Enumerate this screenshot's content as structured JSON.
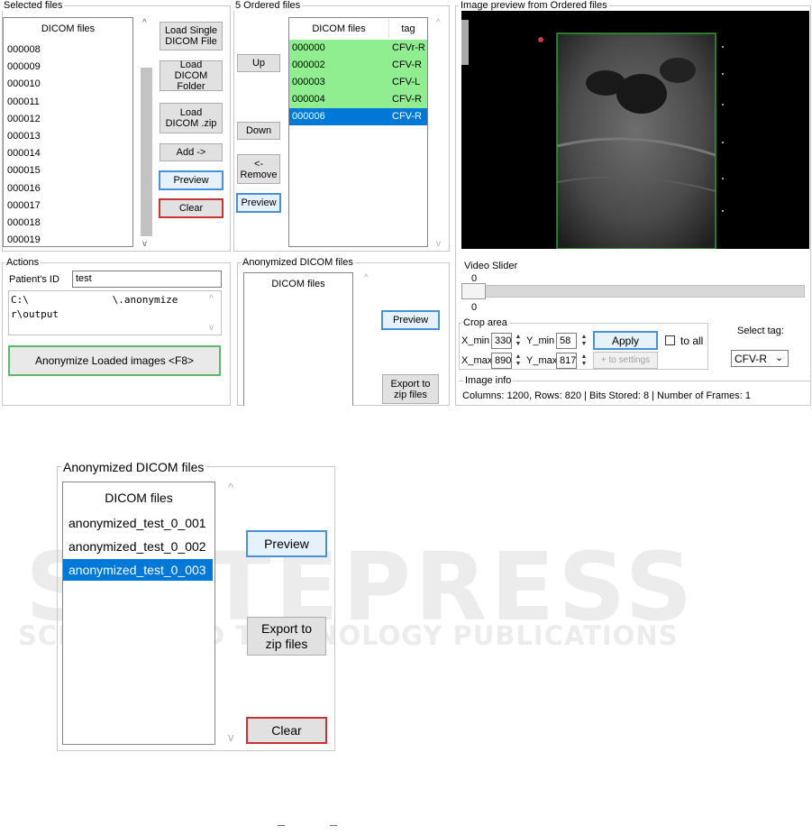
{
  "selected_files": {
    "title": "Selected files",
    "header": "DICOM files",
    "items": [
      "000008",
      "000009",
      "000010",
      "000011",
      "000012",
      "000013",
      "000014",
      "000015",
      "000016",
      "000017",
      "000018",
      "000019"
    ],
    "buttons": {
      "load_single": "Load Single\nDICOM File",
      "load_folder": "Load DICOM\nFolder",
      "load_zip": "Load\nDICOM .zip",
      "add": "Add ->",
      "preview": "Preview",
      "clear": "Clear"
    }
  },
  "ordered_files": {
    "title": "5 Ordered files",
    "header_files": "DICOM files",
    "header_tag": "tag",
    "rows": [
      {
        "file": "000000",
        "tag": "CFVr-R"
      },
      {
        "file": "000002",
        "tag": "CFV-R"
      },
      {
        "file": "000003",
        "tag": "CFV-L"
      },
      {
        "file": "000004",
        "tag": "CFV-R"
      },
      {
        "file": "000006",
        "tag": "CFV-R"
      }
    ],
    "buttons": {
      "up": "Up",
      "down": "Down",
      "remove": "<-\nRemove",
      "preview": "Preview"
    }
  },
  "image_preview": {
    "title": "Image preview from Ordered files",
    "video_slider_label": "Video Slider",
    "slider_value_top": "0",
    "slider_value_bottom": "0",
    "crop": {
      "title": "Crop area",
      "x_min_label": "X_min",
      "x_min": "330",
      "y_min_label": "Y_min",
      "y_min": "58",
      "x_max_label": "X_max",
      "x_max": "890",
      "y_max_label": "Y_max",
      "y_max": "817",
      "apply": "Apply",
      "to_all": "to all",
      "to_settings": "+ to settings"
    },
    "select_tag_label": "Select tag:",
    "select_tag_value": "CFV-R",
    "info_title": "Image info",
    "info_text": "Columns: 1200, Rows: 820  |  Bits Stored: 8  |  Number of Frames: 1"
  },
  "actions": {
    "title": "Actions",
    "patient_id_label": "Patient's ID",
    "patient_id_value": "test",
    "path_line1": "C:\\              \\.anonymize",
    "path_line2": "r\\output",
    "anonymize_button": "Anonymize Loaded images <F8>"
  },
  "anonymized_top": {
    "title": "Anonymized DICOM files",
    "header": "DICOM files",
    "preview": "Preview",
    "export": "Export to\nzip files"
  },
  "anonymized_zoom": {
    "title": "Anonymized DICOM files",
    "header": "DICOM files",
    "items": [
      "anonymized_test_0_001",
      "anonymized_test_0_002",
      "anonymized_test_0_003"
    ],
    "preview": "Preview",
    "export": "Export to\nzip files",
    "clear": "Clear"
  },
  "watermark": {
    "line1": "SCITEPRESS",
    "line2": "SCIENCE AND TECHNOLOGY PUBLICATIONS"
  },
  "colors": {
    "selected_row": "#0078d7",
    "ordered_row": "#90ee90",
    "watermark": "#e6e6e6"
  }
}
